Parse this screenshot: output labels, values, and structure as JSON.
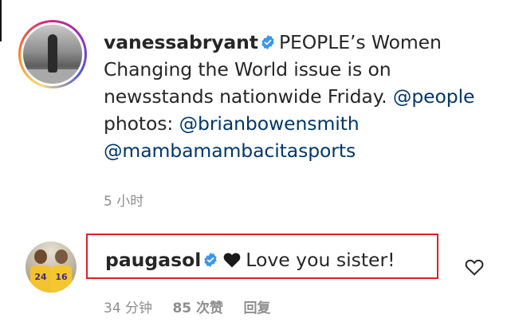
{
  "caption": {
    "username": "vanessabryant",
    "text_before": "PEOPLE’s Women Changing the World issue is on newsstands nationwide Friday.",
    "mention_1": "@people",
    "text_photos": "photos:",
    "mention_2": "@brianbowensmith",
    "mention_3": "@mambamambacitasports",
    "time": "5 小时"
  },
  "comment": {
    "username": "paugasol",
    "text": "Love you sister!",
    "time": "34 分钟",
    "likes": "85 次赞",
    "reply": "回复",
    "jersey_numbers": [
      "24",
      "16"
    ]
  },
  "colors": {
    "mention": "#00376b",
    "verified": "#3897f0",
    "meta": "#8e8e8e",
    "highlight": "#e02020"
  },
  "icons": {
    "verified": "verified-badge-icon",
    "heart_emoji": "black-heart-icon",
    "like": "heart-outline-icon"
  }
}
